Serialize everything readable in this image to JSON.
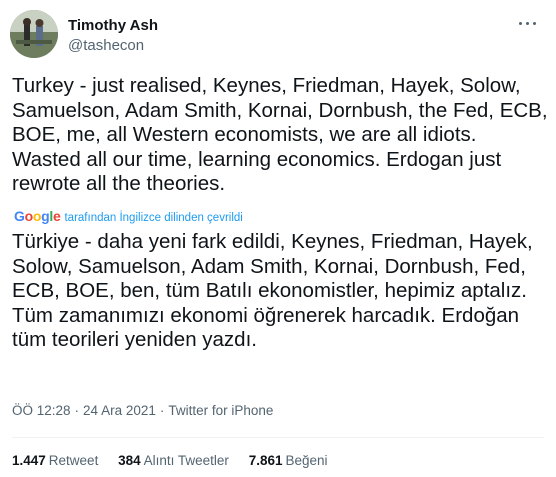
{
  "author": {
    "display_name": "Timothy Ash",
    "handle": "@tashecon"
  },
  "icons": {
    "more": "more-horizontal-icon",
    "google": "google-logo"
  },
  "tweet": {
    "text": "Turkey - just realised, Keynes, Friedman, Hayek, Solow, Samuelson, Adam Smith, Kornai, Dornbush, the Fed, ECB, BOE, me, all Western economists, we are all idiots. Wasted all our time, learning economics. Erdogan just rewrote all the theories.",
    "translation_note": "tarafından İngilizce dilinden çevrildi",
    "google_letters": [
      "G",
      "o",
      "o",
      "g",
      "l",
      "e"
    ],
    "translated_text": "Türkiye - daha yeni fark edildi, Keynes, Friedman, Hayek, Solow, Samuelson, Adam Smith, Kornai, Dornbush, Fed, ECB, BOE, ben, tüm Batılı ekonomistler, hepimiz aptalız. Tüm zamanımızı ekonomi öğrenerek harcadık. Erdoğan tüm teorileri yeniden yazdı."
  },
  "meta": {
    "time": "ÖÖ 12:28",
    "separator": "·",
    "date": "24 Ara 2021",
    "source": "Twitter for iPhone"
  },
  "stats": {
    "retweets_count": "1.447",
    "retweets_label": "Retweet",
    "quotes_count": "384",
    "quotes_label": "Alıntı Tweetler",
    "likes_count": "7.861",
    "likes_label": "Beğeni"
  },
  "colors": {
    "text": "#0f1419",
    "secondary": "#536471",
    "link": "#1d9bf0",
    "divider": "#eff3f4"
  }
}
